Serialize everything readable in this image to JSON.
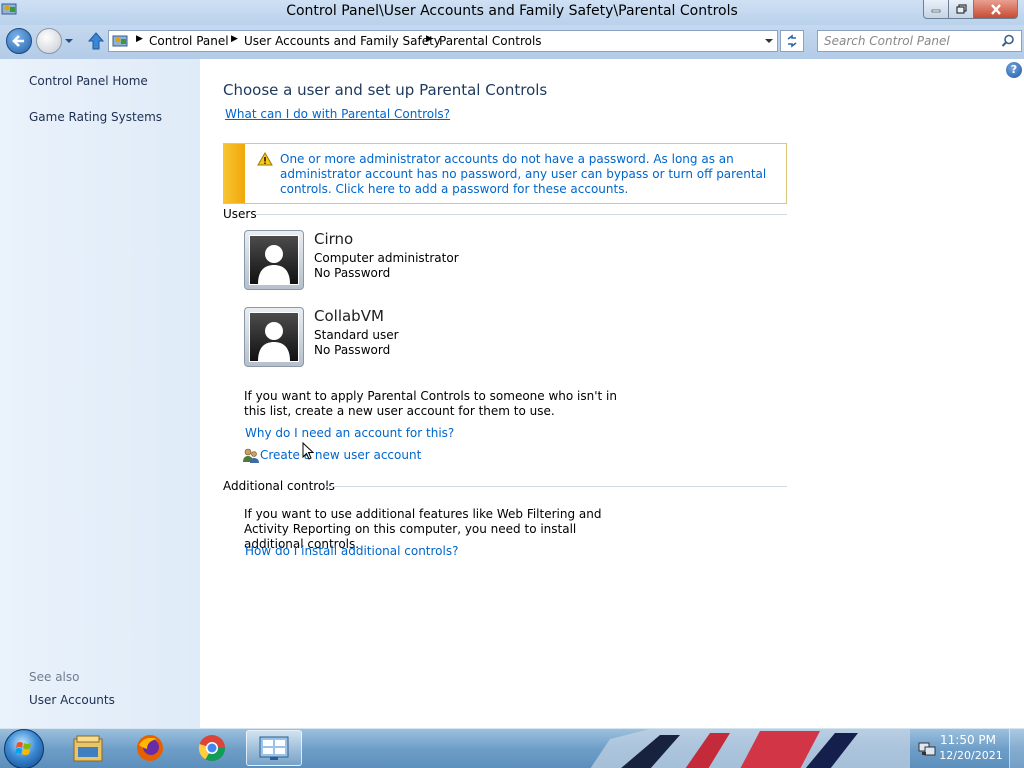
{
  "window": {
    "title": "Control Panel\\User Accounts and Family Safety\\Parental Controls",
    "minimize_icon": "minimize-icon",
    "maximize_icon": "restore-icon",
    "close_icon": "close-icon"
  },
  "address_bar": {
    "breadcrumbs": [
      "Control Panel",
      "User Accounts and Family Safety",
      "Parental Controls"
    ],
    "search_placeholder": "Search Control Panel"
  },
  "left_pane": {
    "links": [
      "Control Panel Home",
      "Game Rating Systems"
    ],
    "see_also_label": "See also",
    "see_also_links": [
      "User Accounts"
    ]
  },
  "main": {
    "title": "Choose a user and set up Parental Controls",
    "help_link": "What can I do with Parental Controls?",
    "warning_text": "One or more administrator accounts do not have a password. As long as an administrator account has no password, any user can bypass or turn off parental controls. Click here to add a password for these accounts.",
    "users_label": "Users",
    "users": [
      {
        "name": "Cirno",
        "role": "Computer administrator",
        "password": "No Password"
      },
      {
        "name": "CollabVM",
        "role": "Standard user",
        "password": "No Password"
      }
    ],
    "not_in_list_text": "If you want to apply Parental Controls to someone who isn't in this list, create a new user account for them to use.",
    "why_account_link": "Why do I need an account for this?",
    "create_account_link": "Create a new user account",
    "additional_label": "Additional controls",
    "additional_text": "If you want to use additional features like Web Filtering and Activity Reporting on this computer, you need to install additional controls.",
    "install_link": "How do I install additional controls?"
  },
  "taskbar": {
    "apps": [
      "windows-explorer-icon",
      "firefox-icon",
      "chrome-icon",
      "control-panel-icon"
    ],
    "active_app": "control-panel-icon",
    "clock_time": "11:50 PM",
    "clock_date": "12/20/2021"
  },
  "colors": {
    "link": "#0066cc",
    "title": "#1e395b",
    "warning_stripe": "#f4b41a"
  }
}
